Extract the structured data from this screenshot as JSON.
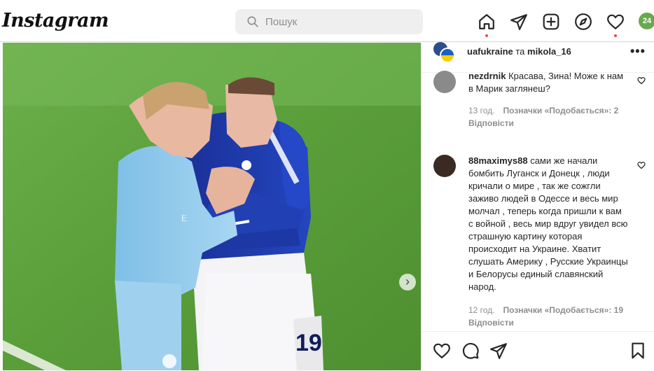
{
  "header": {
    "logo": "Instagram",
    "search_placeholder": "Пошук",
    "profile_badge": "24"
  },
  "post": {
    "author_1": "uafukraine",
    "conjunction": " та ",
    "author_2": "mikola_16",
    "more": "•••"
  },
  "comments": [
    {
      "username": "nezdrnik",
      "text": " Красава, Зина! Може к нам в Марик заглянеш?",
      "time": "13 год.",
      "likes": "Позначки «Подобається»: 2",
      "replies": "Відповісти"
    },
    {
      "username": "88maximys88",
      "text": " сами же начали бомбить Луганск и Донецк , люди кричали о мире , так же сожгли заживо людей в Одессе и весь мир молчал , теперь когда пришли к вам с войной , весь мир вдруг увидел всю страшную картину которая происходит на Украине. Хватит слушать Америку , Русские Украинцы и Белорусы единый славянский народ.",
      "time": "12 год.",
      "likes": "Позначки «Подобається»: 19",
      "replies": "Відповісти"
    }
  ],
  "photo": {
    "jersey_number": "19"
  },
  "colors": {
    "notification": "#ed4956",
    "pitch": "#5fa33f",
    "everton_blue": "#1c3aa8",
    "city_blue": "#8ec8ea"
  }
}
